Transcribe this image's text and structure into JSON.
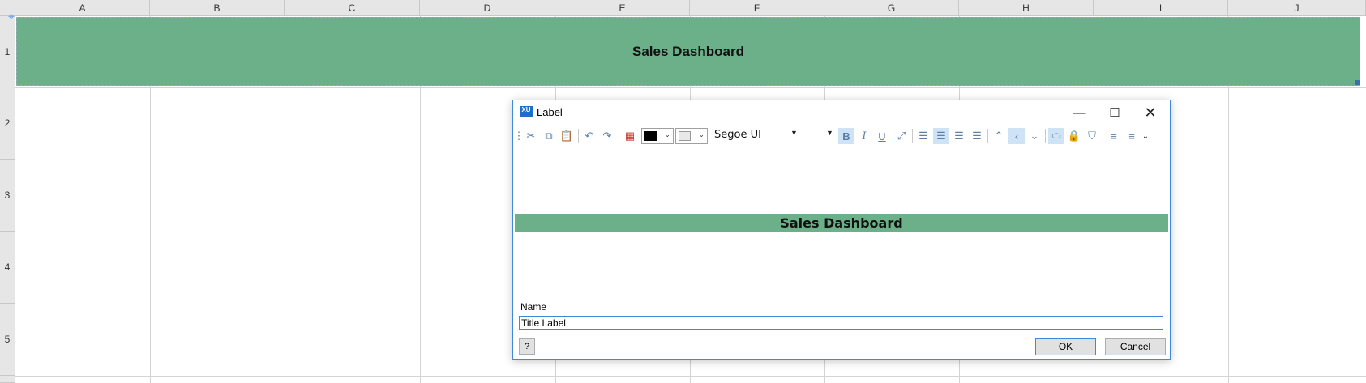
{
  "sheet": {
    "columns": [
      "A",
      "B",
      "C",
      "D",
      "E",
      "F",
      "G",
      "H",
      "I",
      "J"
    ],
    "rows": [
      "1",
      "2",
      "3",
      "4",
      "5"
    ],
    "title_cell_text": "Sales Dashboard",
    "title_fill_color": "#6bb088"
  },
  "dialog": {
    "title": "Label",
    "app_icon_text": "XU",
    "toolbar": {
      "font_name": "Segoe UI",
      "text_color": "#000000",
      "background_color": "#e8e8e8"
    },
    "preview_text": "Sales Dashboard",
    "name_label": "Name",
    "name_value": "Title Label",
    "help_label": "?",
    "ok_label": "OK",
    "cancel_label": "Cancel"
  }
}
